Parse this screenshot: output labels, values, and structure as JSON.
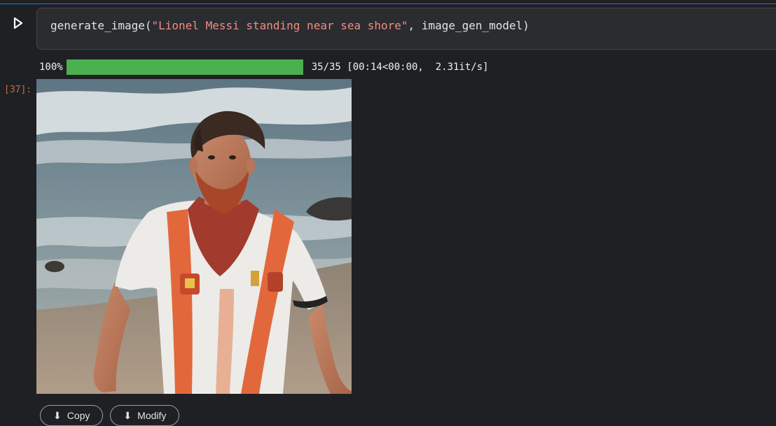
{
  "cell": {
    "code_prefix": "generate_image(",
    "code_string": "\"Lionel Messi standing near sea shore\"",
    "code_suffix": ", image_gen_model)",
    "run_icon": "play-icon"
  },
  "output": {
    "execution_count": "[37]:",
    "progress": {
      "percent_label": "100%",
      "fraction": 1.0,
      "stats": "35/35 [00:14<00:00,  2.31it/s]"
    },
    "image_description_icon": "generated-image",
    "action_buttons": [
      {
        "label": "Copy",
        "icon": "copy-icon"
      },
      {
        "label": "Modify",
        "icon": "edit-icon"
      }
    ]
  },
  "colors": {
    "accent": "#1a73e8",
    "progress_fill": "#4caf50",
    "string_literal": "#f28b82",
    "exec_count": "#d26a3b"
  }
}
